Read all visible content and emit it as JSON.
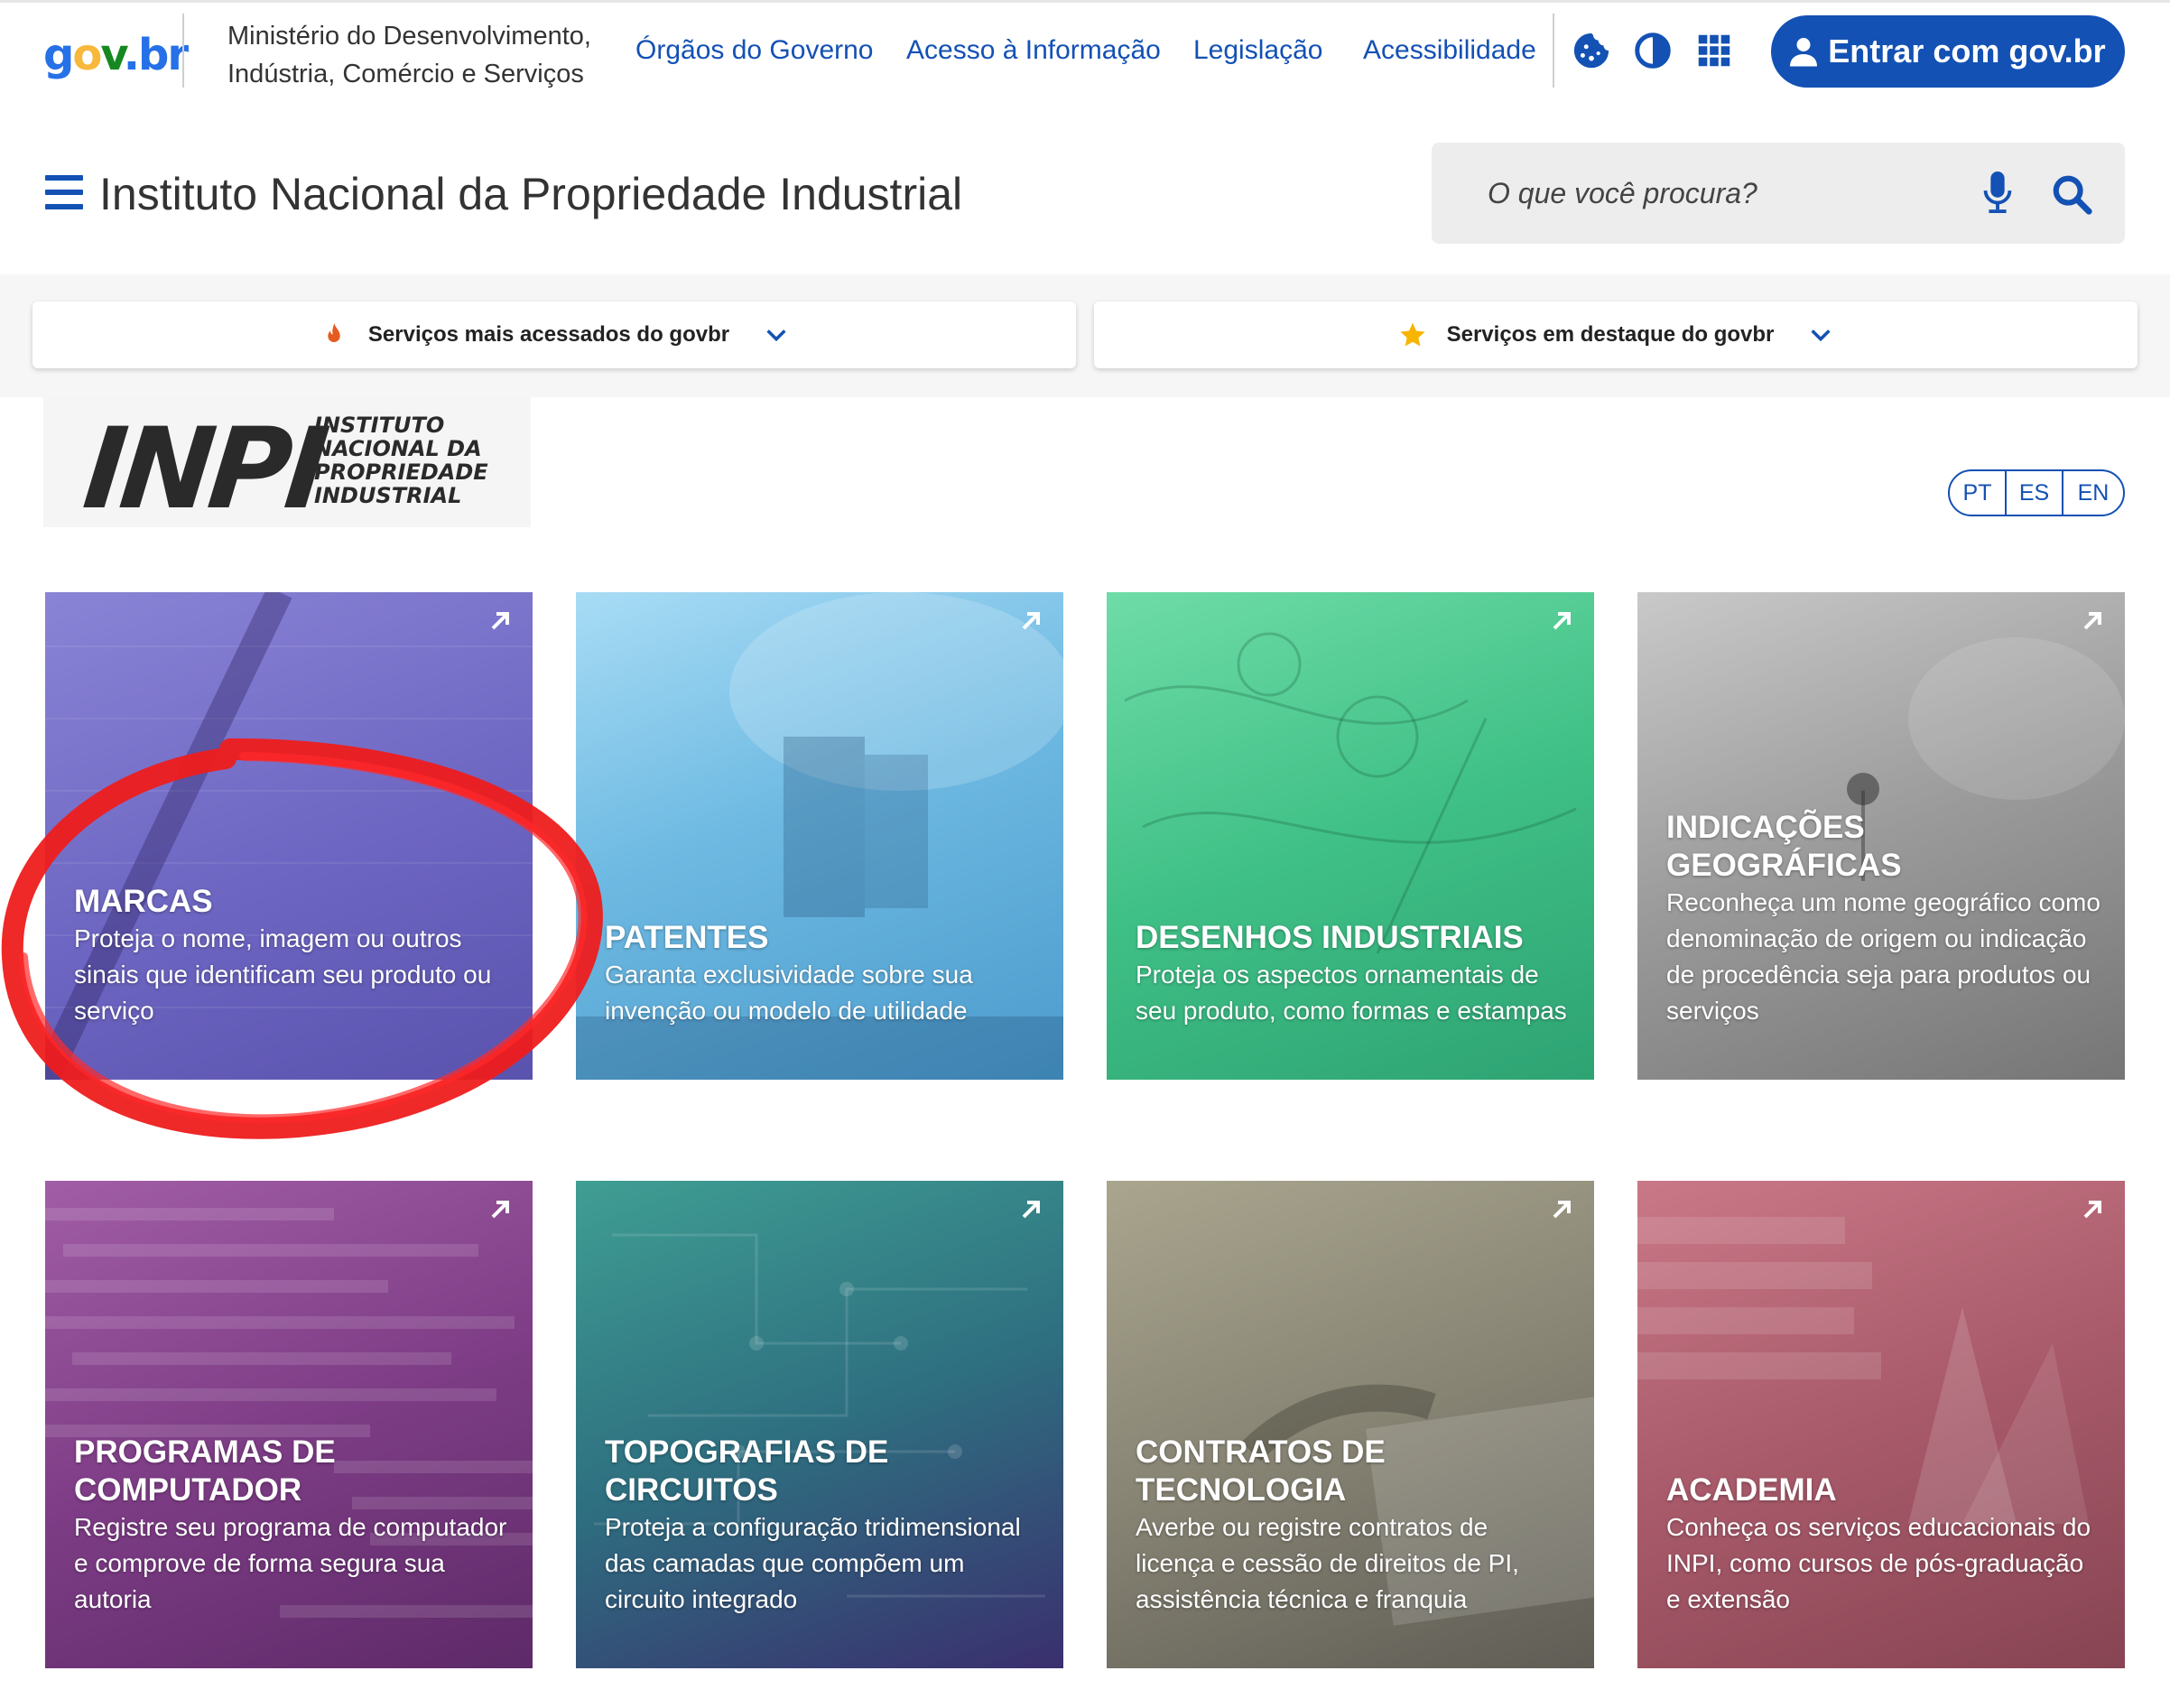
{
  "topbar": {
    "logo": {
      "g": "g",
      "o": "o",
      "v": "v",
      "dot_br": ".br"
    },
    "ministry_line1": "Ministério do Desenvolvimento,",
    "ministry_line2": "Indústria, Comércio e Serviços",
    "nav": [
      {
        "label": "Órgãos do Governo"
      },
      {
        "label": "Acesso à Informação"
      },
      {
        "label": "Legislação"
      },
      {
        "label": "Acessibilidade"
      }
    ],
    "icons": [
      "cookie-icon",
      "contrast-icon",
      "apps-grid-icon"
    ],
    "login_label": "Entrar com gov.br"
  },
  "header": {
    "title": "Instituto Nacional da Propriedade Industrial",
    "search_placeholder": "O que você procura?"
  },
  "services": {
    "most_accessed": "Serviços mais acessados do govbr",
    "featured": "Serviços em destaque do govbr"
  },
  "inpi_logo": {
    "mark": "INPI",
    "line1": "INSTITUTO",
    "line2": "NACIONAL DA",
    "line3": "PROPRIEDADE",
    "line4": "INDUSTRIAL"
  },
  "languages": [
    "PT",
    "ES",
    "EN"
  ],
  "tiles": [
    {
      "title": "MARCAS",
      "desc": "Proteja o nome, imagem ou outros sinais que identificam seu produto ou serviço"
    },
    {
      "title": "PATENTES",
      "desc": "Garanta exclusividade sobre sua invenção ou modelo de utilidade"
    },
    {
      "title": "DESENHOS INDUSTRIAIS",
      "desc": "Proteja os aspectos ornamentais de seu produto, como formas e estampas"
    },
    {
      "title": "INDICAÇÕES GEOGRÁFICAS",
      "desc": "Reconheça um nome geográfico como denominação de origem ou indicação de procedência seja para produtos ou serviços"
    },
    {
      "title": "PROGRAMAS DE COMPUTADOR",
      "desc": "Registre seu programa de computador e comprove de forma segura sua autoria"
    },
    {
      "title": "TOPOGRAFIAS DE CIRCUITOS",
      "desc": "Proteja a configuração tridimensional das camadas que compõem um circuito integrado"
    },
    {
      "title": "CONTRATOS DE TECNOLOGIA",
      "desc": "Averbe ou registre contratos de licença e cessão de direitos de PI, assistência técnica e franquia"
    },
    {
      "title": "ACADEMIA",
      "desc": "Conheça os serviços educacionais do INPI, como cursos de pós-graduação e extensão"
    }
  ],
  "colors": {
    "primary": "#1351b4",
    "annotation": "#ee1c1c"
  }
}
